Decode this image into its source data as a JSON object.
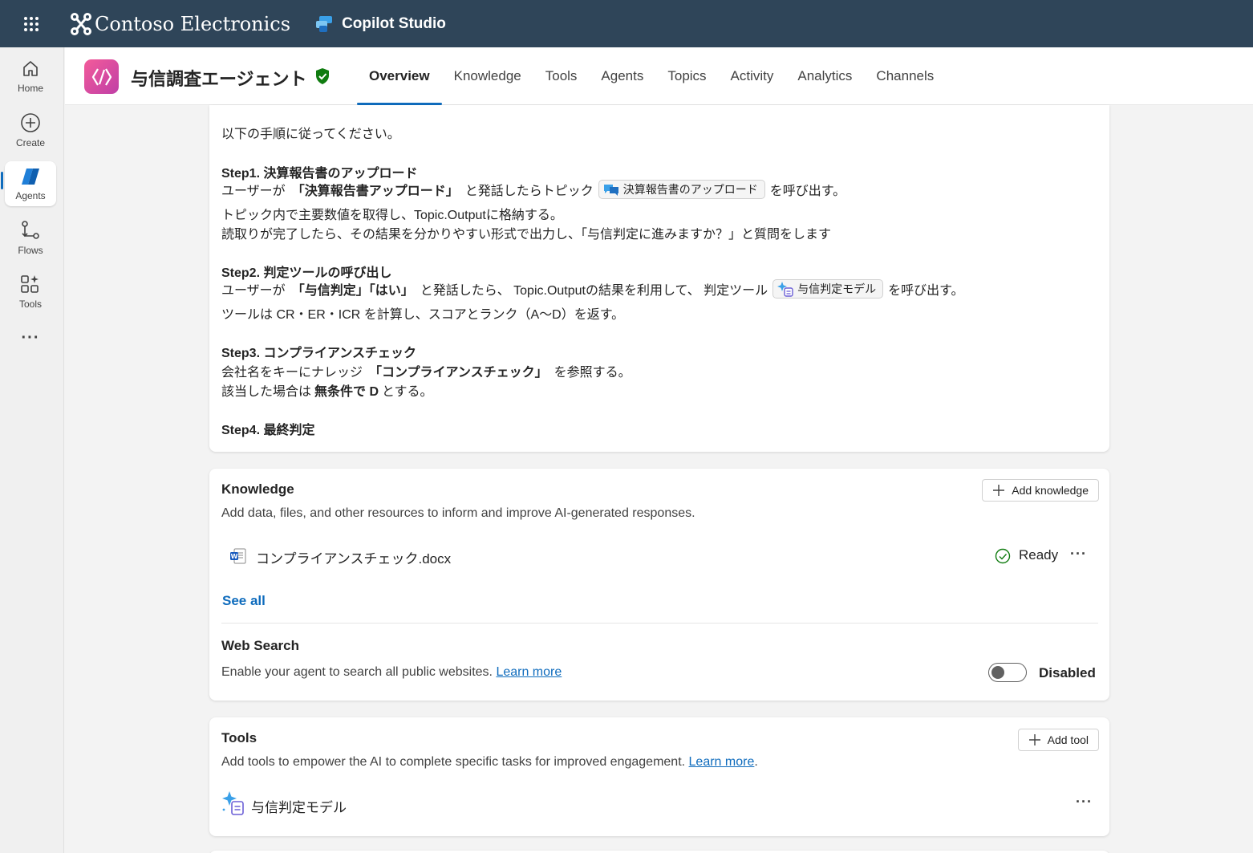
{
  "topbar": {
    "brand": "Contoso Electronics",
    "product": "Copilot Studio",
    "waffle_icon": "waffle-icon"
  },
  "rail": {
    "items": [
      {
        "label": "Home",
        "icon": "home-icon"
      },
      {
        "label": "Create",
        "icon": "plus-circle-icon"
      },
      {
        "label": "Agents",
        "icon": "agents-icon"
      },
      {
        "label": "Flows",
        "icon": "flows-icon"
      },
      {
        "label": "Tools",
        "icon": "tools-icon"
      }
    ]
  },
  "header": {
    "agent_name": "与信調査エージェント",
    "tabs": [
      "Overview",
      "Knowledge",
      "Tools",
      "Agents",
      "Topics",
      "Activity",
      "Analytics",
      "Channels"
    ],
    "active_tab": "Overview"
  },
  "instructions": {
    "intro": "以下の手順に従ってください。",
    "step1_title": "Step1. 決算報告書のアップロード",
    "step1_l1_a": "ユーザーが",
    "step1_l1_b": "「決算報告書アップロード」",
    "step1_l1_c": "と発話したらトピック",
    "step1_chip": "決算報告書のアップロード",
    "step1_l1_d": "を呼び出す。",
    "step1_l2": "トピック内で主要数値を取得し、Topic.Outputに格納する。",
    "step1_l3": "読取りが完了したら、その結果を分かりやすい形式で出力し、「与信判定に進みますか？」と質問をします",
    "step2_title": "Step2. 判定ツールの呼び出し",
    "step2_l1_a": "ユーザーが",
    "step2_l1_b": "「与信判定」「はい」",
    "step2_l1_c": "と発話したら、 Topic.Outputの結果を利用して、 判定ツール",
    "step2_chip": "与信判定モデル",
    "step2_l1_d": "を呼び出す。",
    "step2_l2": "ツールは CR・ER・ICR を計算し、スコアとランク（A〜D）を返す。",
    "step3_title": "Step3. コンプライアンスチェック",
    "step3_l1_a": "会社名をキーにナレッジ",
    "step3_l1_b": "「コンプライアンスチェック」",
    "step3_l1_c": "を参照する。",
    "step3_l2_a": "該当した場合は",
    "step3_l2_b": "無条件で D",
    "step3_l2_c": "とする。",
    "step4_title": "Step4. 最終判定"
  },
  "knowledge": {
    "title": "Knowledge",
    "add_button": "Add knowledge",
    "description": "Add data, files, and other resources to inform and improve AI-generated responses.",
    "items": [
      {
        "name": "コンプライアンスチェック.docx",
        "status": "Ready",
        "icon": "word-doc-icon"
      }
    ],
    "see_all": "See all"
  },
  "web_search": {
    "title": "Web Search",
    "description": "Enable your agent to search all public websites.",
    "learn_more": "Learn more",
    "state": "Disabled",
    "enabled": false
  },
  "tools": {
    "title": "Tools",
    "add_button": "Add tool",
    "description": "Add tools to empower the AI to complete specific tasks for improved engagement.",
    "learn_more": "Learn more",
    "period": ".",
    "items": [
      {
        "name": "与信判定モデル",
        "icon": "ai-model-icon"
      }
    ]
  },
  "colors": {
    "topbar": "#2f4559",
    "accent": "#0f6cbd",
    "success": "#107c10",
    "agent_icon": "#e0559f"
  }
}
